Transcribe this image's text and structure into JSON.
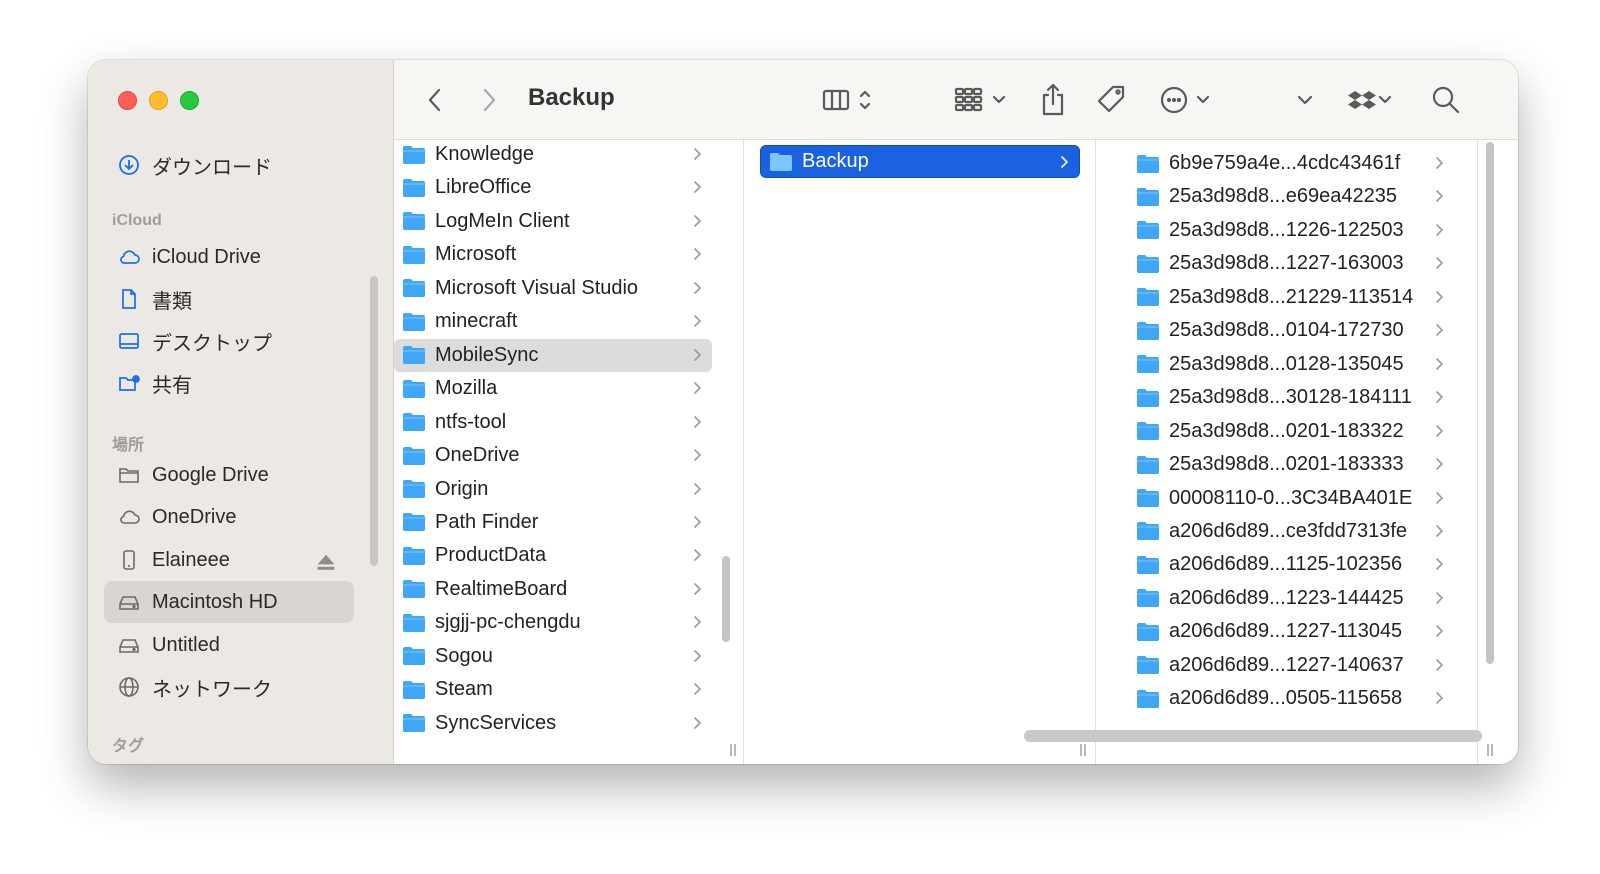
{
  "window": {
    "title": "Backup"
  },
  "sidebar": {
    "items_top": [
      {
        "label": "ダウンロード",
        "icon": "download-icon"
      }
    ],
    "icloud_header": "iCloud",
    "icloud_items": [
      {
        "label": "iCloud Drive",
        "icon": "cloud-icon"
      },
      {
        "label": "書類",
        "icon": "document-icon"
      },
      {
        "label": "デスクトップ",
        "icon": "desktop-icon"
      },
      {
        "label": "共有",
        "icon": "shared-folder-icon"
      }
    ],
    "places_header": "場所",
    "places_items": [
      {
        "label": "Google Drive",
        "icon": "folder-icon"
      },
      {
        "label": "OneDrive",
        "icon": "cloud-icon"
      },
      {
        "label": "Elaineee",
        "icon": "iphone-icon"
      },
      {
        "label": "Macintosh HD",
        "icon": "disk-icon",
        "selected": true
      },
      {
        "label": "Untitled",
        "icon": "disk-icon"
      },
      {
        "label": "ネットワーク",
        "icon": "globe-icon"
      }
    ],
    "tags_header": "タグ"
  },
  "column1": [
    "Knowledge",
    "LibreOffice",
    "LogMeIn Client",
    "Microsoft",
    "Microsoft Visual Studio",
    "minecraft",
    "MobileSync",
    "Mozilla",
    "ntfs-tool",
    "OneDrive",
    "Origin",
    "Path Finder",
    "ProductData",
    "RealtimeBoard",
    "sjgjj-pc-chengdu",
    "Sogou",
    "Steam",
    "SyncServices"
  ],
  "column1_highlighted": "MobileSync",
  "column2": [
    "Backup"
  ],
  "column3": [
    "6b9e759a4e...4cdc43461f",
    "25a3d98d8...e69ea42235",
    "25a3d98d8...1226-122503",
    "25a3d98d8...1227-163003",
    "25a3d98d8...21229-113514",
    "25a3d98d8...0104-172730",
    "25a3d98d8...0128-135045",
    "25a3d98d8...30128-184111",
    "25a3d98d8...0201-183322",
    "25a3d98d8...0201-183333",
    "00008110-0...3C34BA401E",
    "a206d6d89...ce3fdd7313fe",
    "a206d6d89...1125-102356",
    "a206d6d89...1223-144425",
    "a206d6d89...1227-113045",
    "a206d6d89...1227-140637",
    "a206d6d89...0505-115658"
  ],
  "colors": {
    "accent": "#1a62e0",
    "folder": "#3fa7f5",
    "sidebar_bg": "#ece9e4"
  }
}
